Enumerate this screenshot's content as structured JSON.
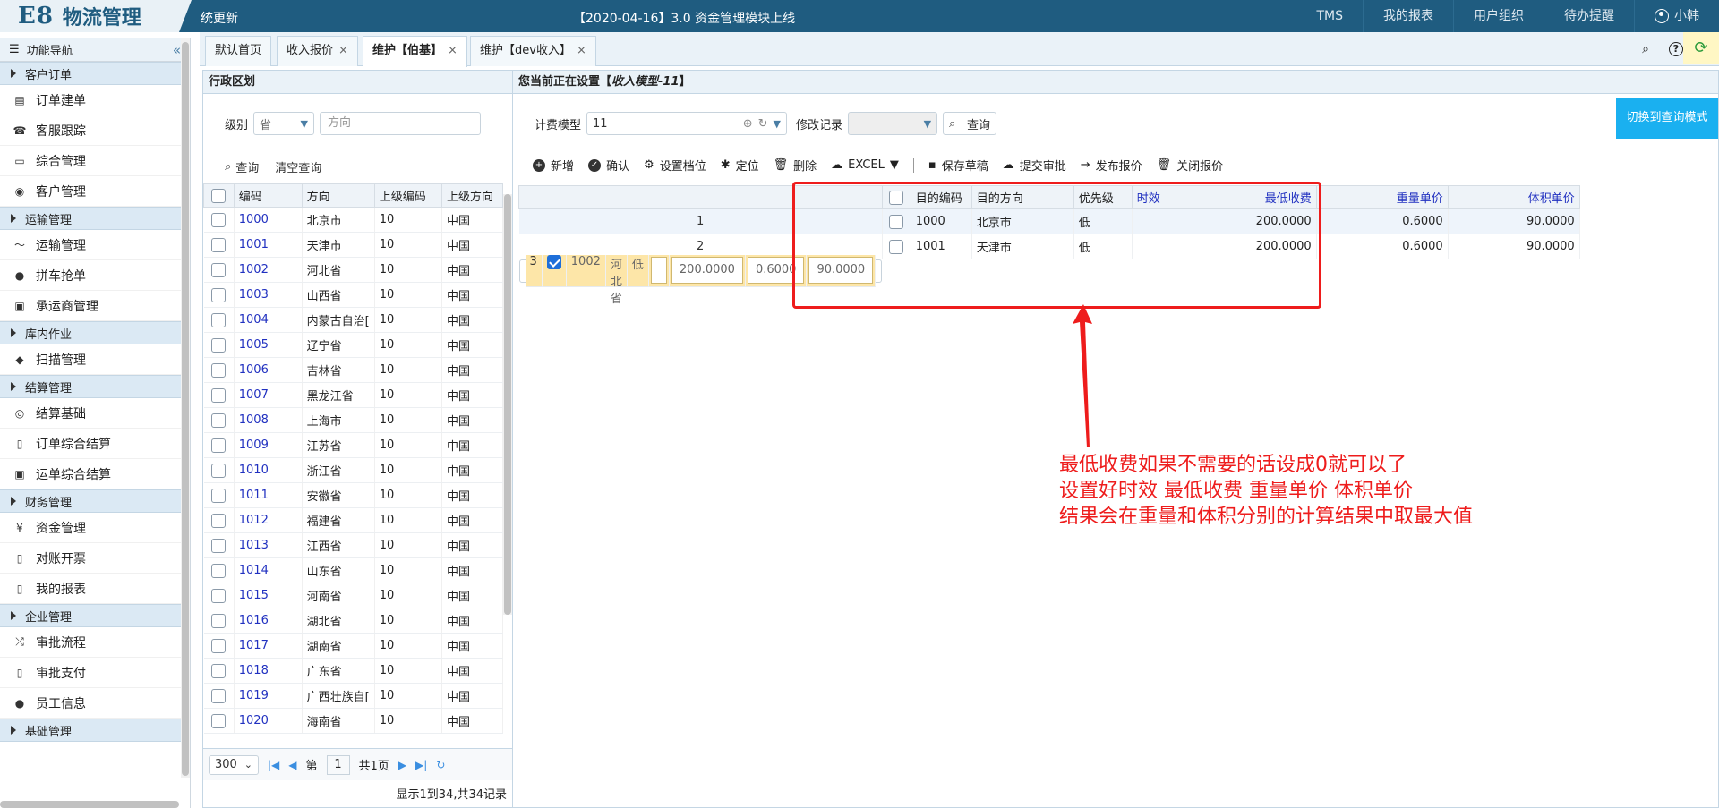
{
  "app": {
    "logo_main": "E8",
    "logo_sub": "物流管理",
    "user_name": "统更新",
    "notice": "【2020-04-16】3.0 资金管理模块上线"
  },
  "topnav": [
    "TMS",
    "我的报表",
    "用户组织",
    "待办提醒",
    "小韩"
  ],
  "sidebar": {
    "title": "功能导航",
    "groups": [
      {
        "label": "客户订单",
        "items": [
          "订单建单",
          "客服跟踪",
          "综合管理",
          "客户管理"
        ]
      },
      {
        "label": "运输管理",
        "items": [
          "运输管理",
          "拼车抢单",
          "承运商管理"
        ]
      },
      {
        "label": "库内作业",
        "items": [
          "扫描管理"
        ]
      },
      {
        "label": "结算管理",
        "items": [
          "结算基础",
          "订单综合结算",
          "运单综合结算"
        ]
      },
      {
        "label": "财务管理",
        "items": [
          "资金管理",
          "对账开票",
          "我的报表"
        ]
      },
      {
        "label": "企业管理",
        "items": [
          "审批流程",
          "审批支付",
          "员工信息"
        ]
      },
      {
        "label": "基础管理",
        "items": []
      }
    ]
  },
  "tabs": [
    {
      "label": "默认首页",
      "closable": false
    },
    {
      "label": "收入报价",
      "closable": true
    },
    {
      "label": "维护【伯基】",
      "closable": true,
      "active": true
    },
    {
      "label": "维护【dev收入】",
      "closable": true
    }
  ],
  "left": {
    "title": "行政区划",
    "level_label": "级别",
    "level_value": "省",
    "direction_placeholder": "方向",
    "query": "查询",
    "clear": "清空查询",
    "columns": [
      "编码",
      "方向",
      "上级编码",
      "上级方向"
    ],
    "rows": [
      [
        "1000",
        "北京市",
        "10",
        "中国"
      ],
      [
        "1001",
        "天津市",
        "10",
        "中国"
      ],
      [
        "1002",
        "河北省",
        "10",
        "中国"
      ],
      [
        "1003",
        "山西省",
        "10",
        "中国"
      ],
      [
        "1004",
        "内蒙古自治[",
        "10",
        "中国"
      ],
      [
        "1005",
        "辽宁省",
        "10",
        "中国"
      ],
      [
        "1006",
        "吉林省",
        "10",
        "中国"
      ],
      [
        "1007",
        "黑龙江省",
        "10",
        "中国"
      ],
      [
        "1008",
        "上海市",
        "10",
        "中国"
      ],
      [
        "1009",
        "江苏省",
        "10",
        "中国"
      ],
      [
        "1010",
        "浙江省",
        "10",
        "中国"
      ],
      [
        "1011",
        "安徽省",
        "10",
        "中国"
      ],
      [
        "1012",
        "福建省",
        "10",
        "中国"
      ],
      [
        "1013",
        "江西省",
        "10",
        "中国"
      ],
      [
        "1014",
        "山东省",
        "10",
        "中国"
      ],
      [
        "1015",
        "河南省",
        "10",
        "中国"
      ],
      [
        "1016",
        "湖北省",
        "10",
        "中国"
      ],
      [
        "1017",
        "湖南省",
        "10",
        "中国"
      ],
      [
        "1018",
        "广东省",
        "10",
        "中国"
      ],
      [
        "1019",
        "广西壮族自[",
        "10",
        "中国"
      ],
      [
        "1020",
        "海南省",
        "10",
        "中国"
      ]
    ],
    "pager": {
      "size": "300",
      "page_prefix": "第",
      "page": "1",
      "page_suffix": "共1页",
      "info": "显示1到34,共34记录"
    }
  },
  "right": {
    "title_prefix": "您当前正在设置【",
    "title_model": "收入模型-11",
    "title_suffix": "】",
    "model_label": "计费模型",
    "model_value": "11",
    "history_label": "修改记录",
    "query": "查询",
    "switch": "切换到查询模式",
    "toolbar": [
      "新增",
      "确认",
      "设置档位",
      "定位",
      "删除",
      "EXCEL",
      "保存草稿",
      "提交审批",
      "发布报价",
      "关闭报价"
    ],
    "columns": [
      "目的编码",
      "目的方向",
      "优先级",
      "时效",
      "最低收费",
      "重量单价",
      "体积单价"
    ],
    "rows": [
      {
        "num": "1",
        "code": "1000",
        "dir": "北京市",
        "pri": "低",
        "time": "",
        "min": "200.0000",
        "weight": "0.6000",
        "volume": "90.0000",
        "checked": false
      },
      {
        "num": "2",
        "code": "1001",
        "dir": "天津市",
        "pri": "低",
        "time": "",
        "min": "200.0000",
        "weight": "0.6000",
        "volume": "90.0000",
        "checked": false
      },
      {
        "num": "3",
        "code": "1002",
        "dir": "河北省",
        "pri": "低",
        "time": "",
        "min": "200.0000",
        "weight": "0.6000",
        "volume": "90.0000",
        "checked": true
      }
    ]
  },
  "annotation": [
    "最低收费如果不需要的话设成0就可以了",
    "设置好时效 最低收费 重量单价 体积单价",
    "结果会在重量和体积分别的计算结果中取最大值"
  ],
  "colors": {
    "topbar": "#1f5c80",
    "accent": "#1ab0f0",
    "annotation": "#ee1c1c",
    "selected_row": "#fde6a8",
    "code_link": "#2030c0"
  }
}
